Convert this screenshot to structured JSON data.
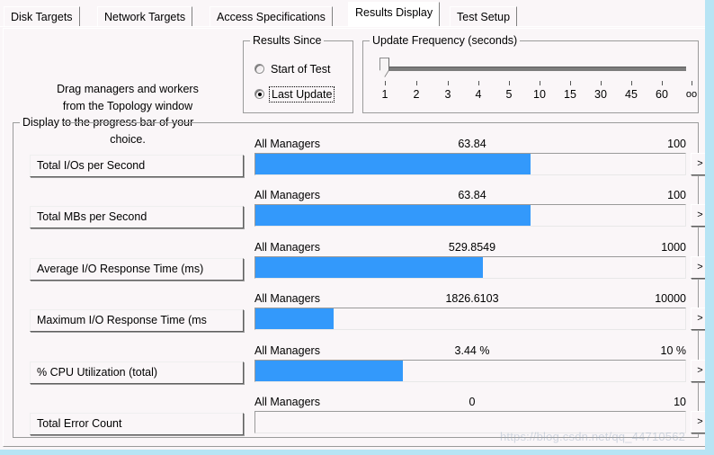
{
  "window": {
    "accent_color": "#b7e4f4",
    "bar_color": "#3399fb",
    "surface_color": "#faf6f8"
  },
  "tabs": [
    {
      "label": "Disk Targets",
      "active": false
    },
    {
      "label": "Network Targets",
      "active": false
    },
    {
      "label": "Access Specifications",
      "active": false
    },
    {
      "label": "Results Display",
      "active": true
    },
    {
      "label": "Test Setup",
      "active": false
    }
  ],
  "drag_hint": {
    "line1": "Drag managers and workers",
    "line2": "from the Topology window",
    "line3": "to the progress bar of your",
    "line4": "choice."
  },
  "results_since": {
    "legend": "Results Since",
    "options": [
      {
        "label": "Start of Test",
        "selected": false,
        "focused": false
      },
      {
        "label": "Last Update",
        "selected": true,
        "focused": true
      }
    ]
  },
  "update_frequency": {
    "legend": "Update Frequency (seconds)",
    "ticks": [
      "1",
      "2",
      "3",
      "4",
      "5",
      "10",
      "15",
      "30",
      "45",
      "60",
      "oo"
    ],
    "selected_index": 0,
    "selected_value": "1"
  },
  "display": {
    "legend": "Display",
    "go_button_label": ">",
    "rows": [
      {
        "metric_label": "Total I/Os per Second",
        "manager": "All Managers",
        "value": "63.84",
        "max": "100",
        "fill_percent": 64
      },
      {
        "metric_label": "Total MBs per Second",
        "manager": "All Managers",
        "value": "63.84",
        "max": "100",
        "fill_percent": 64
      },
      {
        "metric_label": "Average I/O Response Time (ms)",
        "manager": "All Managers",
        "value": "529.8549",
        "max": "1000",
        "fill_percent": 53
      },
      {
        "metric_label": "Maximum I/O Response Time (ms",
        "manager": "All Managers",
        "value": "1826.6103",
        "max": "10000",
        "fill_percent": 18.3
      },
      {
        "metric_label": "% CPU Utilization (total)",
        "manager": "All Managers",
        "value": "3.44 %",
        "max": "10 %",
        "fill_percent": 34.4
      },
      {
        "metric_label": "Total Error Count",
        "manager": "All Managers",
        "value": "0",
        "max": "10",
        "fill_percent": 0
      }
    ]
  },
  "watermark": {
    "text": "https://blog.csdn.net/qq_44710562"
  }
}
